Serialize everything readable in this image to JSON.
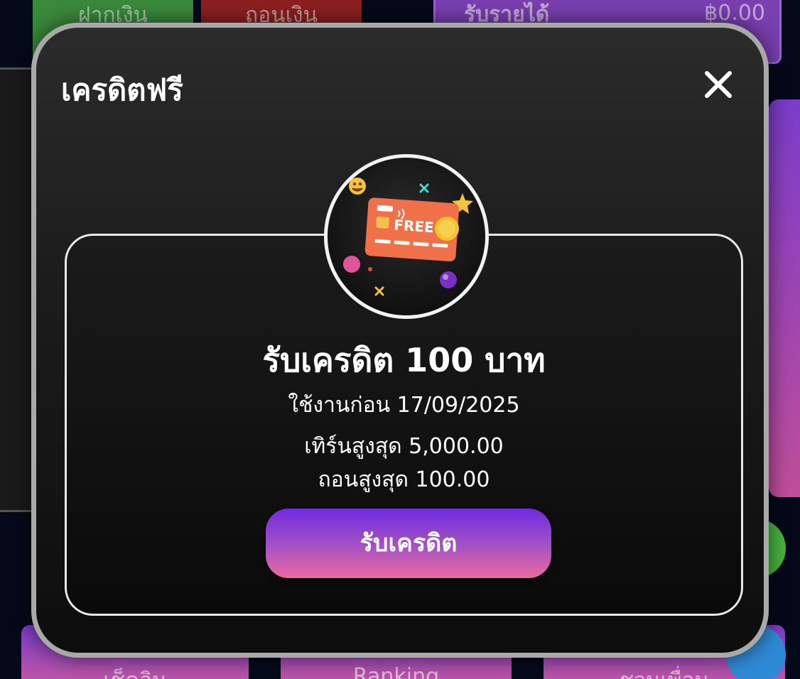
{
  "background": {
    "deposit_label": "ฝากเงิน",
    "withdraw_label": "ถอนเงิน",
    "income_label": "รับรายได้",
    "income_amount": "฿0.00",
    "bottom_left_label": "เช็คอิน",
    "bottom_mid_label": "Ranking",
    "bottom_right_label": "ชวนเพื่อน"
  },
  "modal": {
    "title": "เครดิตฟรี",
    "badge_text": "FREE",
    "credit_title": "รับเครดิต 100 บาท",
    "expire_line": "ใช้งานก่อน 17/09/2025",
    "turnover_line": "เทิร์นสูงสุด 5,000.00",
    "max_withdraw_line": "ถอนสูงสุด 100.00",
    "claim_button": "รับเครดิต"
  },
  "colors": {
    "claim_gradient_top": "#6f2be0",
    "claim_gradient_bottom": "#ea6aa0",
    "modal_border": "#a9a9a9",
    "card_orange": "#f07049"
  },
  "icons": [
    "close-icon",
    "free-credit-card-icon"
  ]
}
